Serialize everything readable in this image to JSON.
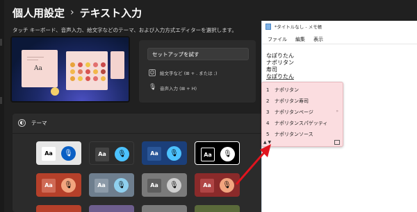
{
  "header": {
    "title": "個人用設定",
    "separator": "›",
    "subtitle": "テキスト入力"
  },
  "description": "タッチ キーボード、音声入力、絵文字などのテーマ、および入力方式エディターを選択します。",
  "preview": {
    "aa_label": "Aa"
  },
  "setup": {
    "button_label": "セットアップを試す",
    "emoji_label": "絵文字など (⊞ + . または ;)",
    "voice_label": "音声入力 (⊞ + H)"
  },
  "theme": {
    "label": "テーマ",
    "tile_label": "Aa",
    "mic_glyph": "🎙"
  },
  "notepad": {
    "title": "*タイトルなし - メモ帳",
    "menu": [
      "ファイル",
      "編集",
      "表示"
    ],
    "lines": [
      "なぽりたん",
      "ナポリタン",
      "寿司",
      "なぽりたん"
    ]
  },
  "ime": {
    "candidates": [
      {
        "num": "1",
        "text": "ナポリタン"
      },
      {
        "num": "2",
        "text": "ナポリタン寿司"
      },
      {
        "num": "3",
        "text": "ナポリタンページ"
      },
      {
        "num": "4",
        "text": "ナポリタンスパゲッティ"
      },
      {
        "num": "5",
        "text": "ナポリタンソース"
      }
    ],
    "nav": "▲  ▼",
    "expand_glyph": "»"
  },
  "colors": {
    "background": "#202020",
    "panel": "#2b2b2b",
    "accent_arrow": "#e0141e",
    "ime_background": "#fbdde0"
  }
}
